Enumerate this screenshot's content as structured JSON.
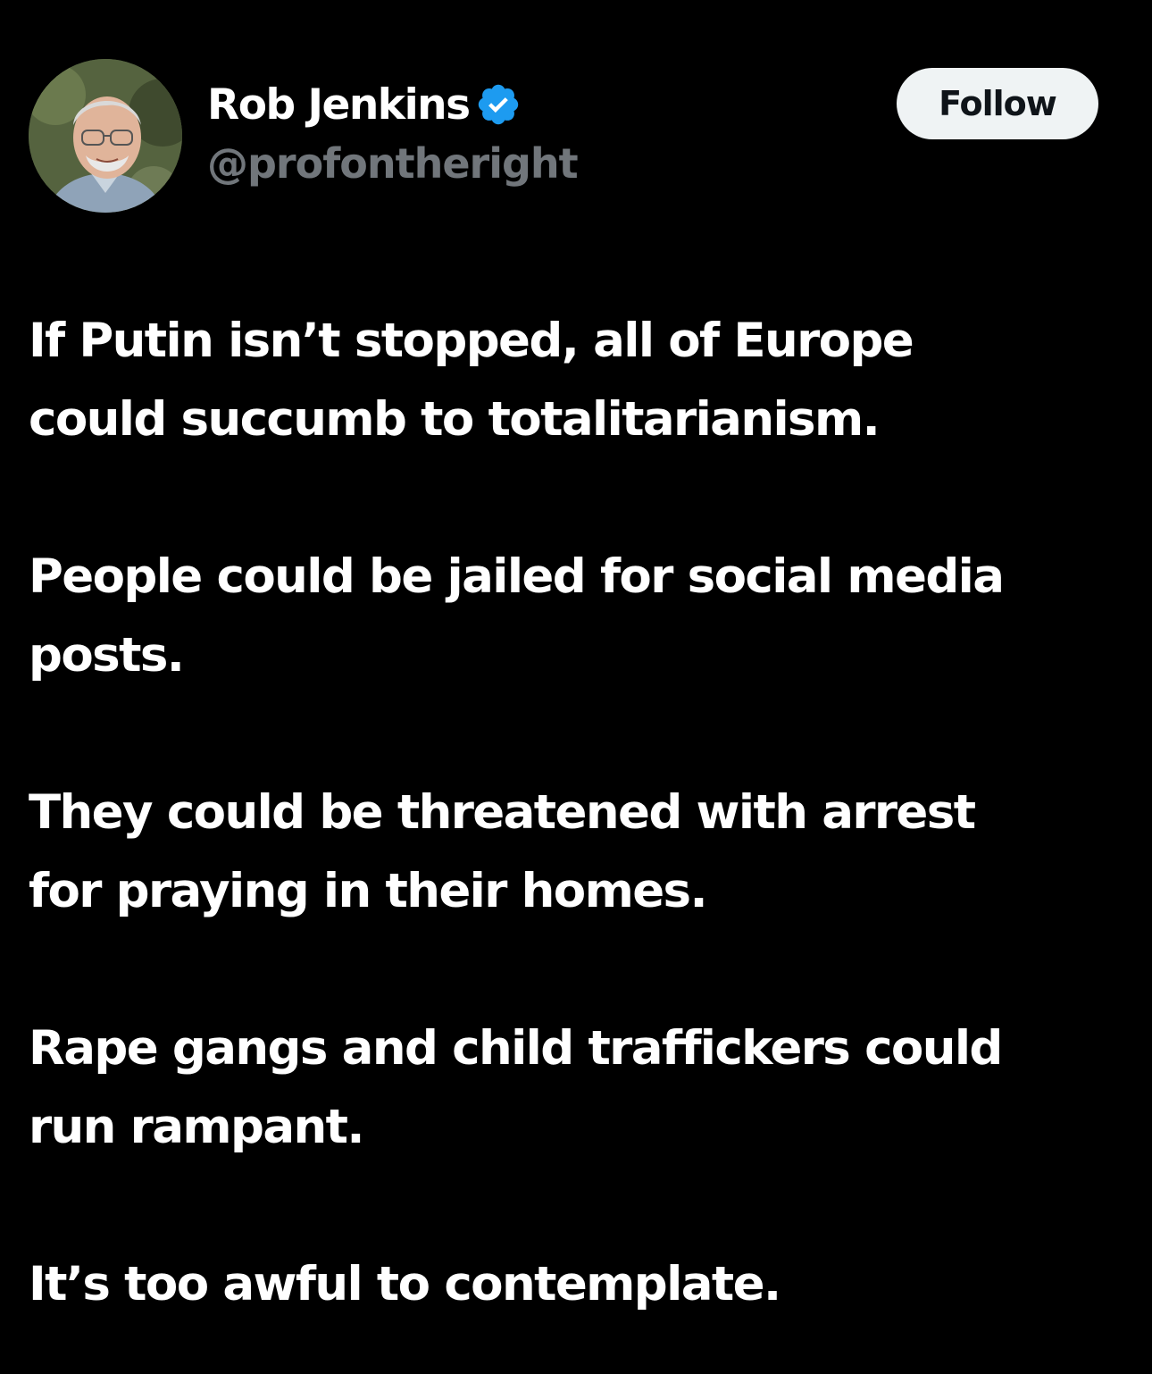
{
  "tweet": {
    "author": {
      "display_name": "Rob Jenkins",
      "handle": "@profontheright",
      "verified": true,
      "avatar_icon": "profile-photo"
    },
    "follow_label": "Follow",
    "paragraphs": [
      "If Putin isn’t stopped, all of Europe\ncould succumb to totalitarianism.",
      "People could be jailed for social media\nposts.",
      "They could be threatened with arrest\nfor praying in their homes.",
      "Rape gangs and child traffickers could\nrun rampant.",
      "It’s too awful to contemplate."
    ]
  },
  "colors": {
    "background": "#000000",
    "text": "#ffffff",
    "handle": "#71767b",
    "verified_badge": "#1d9bf0",
    "follow_bg": "#eff3f4",
    "follow_text": "#0f1419"
  }
}
